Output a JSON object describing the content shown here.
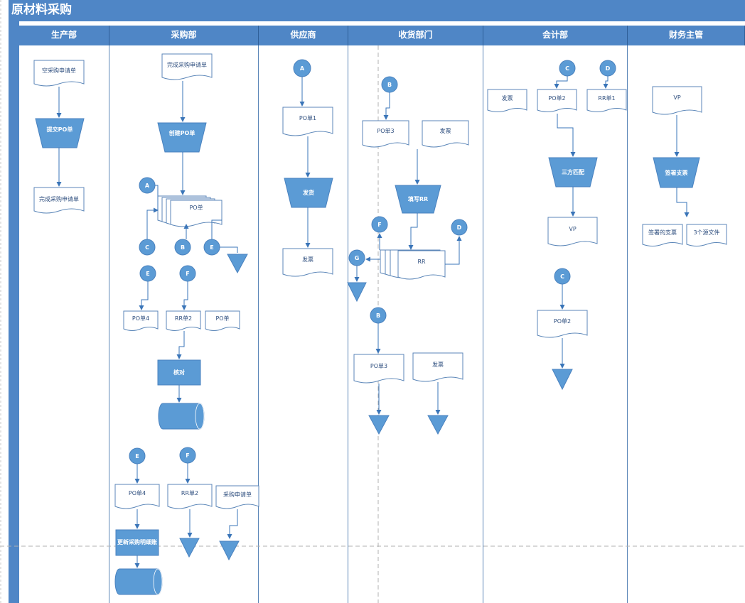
{
  "title": "原材料采购",
  "lanes": [
    "生产部",
    "采购部",
    "供应商",
    "收货部门",
    "会计部",
    "财务主管"
  ],
  "labels": {
    "prod_empty_req": "空采购申请单",
    "prod_submit_po": "提交PO单",
    "prod_done_req": "完成采购申请单",
    "pur_done_req": "完成采购申请单",
    "pur_create_po": "创建PO单",
    "pur_po_stack": "PO单",
    "pur_po4": "PO单4",
    "pur_rr2": "RR单2",
    "pur_po": "PO单",
    "pur_check": "核对",
    "pur_po4_b": "PO单4",
    "pur_rr2_b": "RR单2",
    "pur_req_b": "采购申请单",
    "pur_update": "更新采购明细账",
    "sup_po1": "PO单1",
    "sup_ship": "发货",
    "sup_invoice": "发票",
    "rec_po3": "PO单3",
    "rec_invoice": "发票",
    "rec_fill_rr": "填写RR",
    "rec_rr": "RR",
    "rec_po3_b": "PO单3",
    "rec_invoice_b": "发票",
    "acc_invoice": "发票",
    "acc_po2": "PO单2",
    "acc_rr1": "RR单1",
    "acc_match": "三方匹配",
    "acc_vp": "VP",
    "acc_po2_b": "PO单2",
    "fin_vp": "VP",
    "fin_sign": "签署支票",
    "fin_signed": "签署的支票",
    "fin_three_docs": "3个源文件"
  },
  "connectors": {
    "a": "A",
    "b": "B",
    "c": "C",
    "d": "D",
    "e": "E",
    "f": "F",
    "g": "G"
  },
  "colors": {
    "header_bg": "#4f86c6",
    "shape_fill": "#5b9bd5",
    "line": "#3a75b8",
    "doc_stroke": "#5b86b8",
    "divider": "#b0b0b0"
  }
}
